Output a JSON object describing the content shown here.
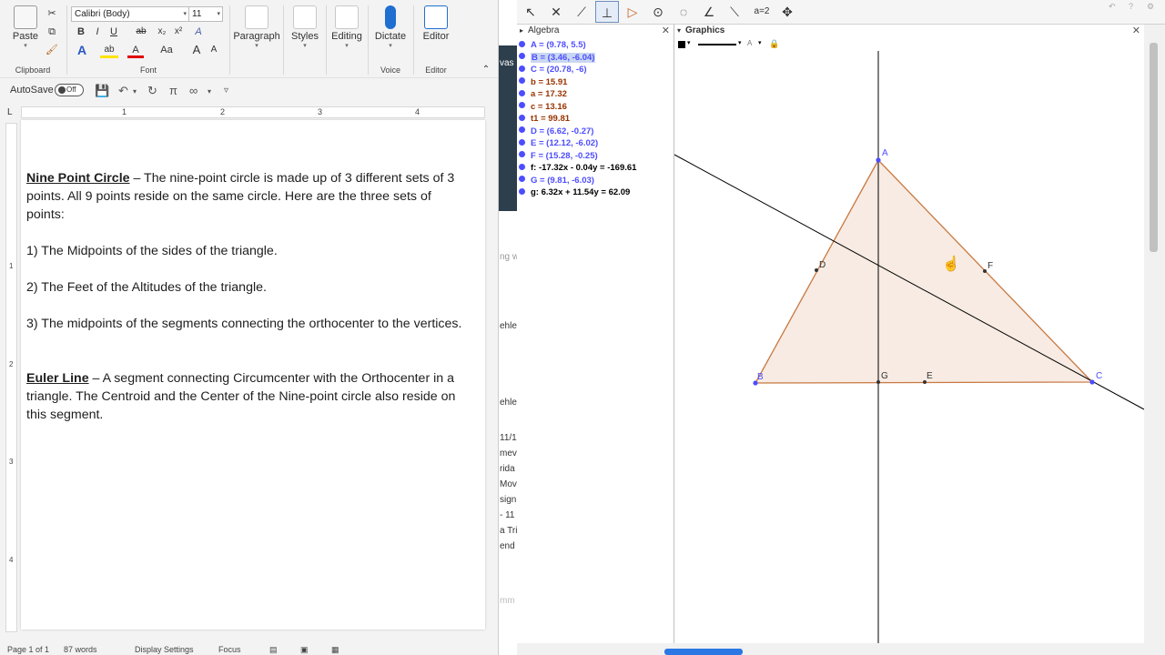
{
  "word": {
    "ribbon": {
      "clipboard": {
        "paste": "Paste",
        "label": "Clipboard"
      },
      "font": {
        "name": "Calibri (Body)",
        "size": "11",
        "bold": "B",
        "italic": "I",
        "underline": "U",
        "strike": "ab",
        "subscript": "x₂",
        "superscript": "x²",
        "clear": "A",
        "effects": "A",
        "highlight": "ab",
        "color": "A",
        "case": "Aa",
        "grow": "A",
        "shrink": "A",
        "label": "Font"
      },
      "paragraph": "Paragraph",
      "styles": "Styles",
      "editing": "Editing",
      "dictate": "Dictate",
      "voice": "Voice",
      "editor": "Editor",
      "editor_group": "Editor"
    },
    "qat": {
      "autosave": "AutoSave",
      "toggle": "Off"
    },
    "ruler": [
      "1",
      "2",
      "3",
      "4"
    ],
    "vruler": [
      "1",
      "2",
      "3",
      "4"
    ],
    "document": {
      "nine_point_term": "Nine Point Circle",
      "nine_point_def": " – The nine-point circle is made up of 3 different sets of 3 points.  All 9 points reside on the same circle.  Here are the three sets of points:",
      "item1": "1)  The Midpoints of the sides of the triangle.",
      "item2": "2)  The Feet of the Altitudes of the triangle.",
      "item3": "3)  The midpoints of the segments connecting the orthocenter to the vertices.",
      "euler_term": "Euler Line",
      "euler_def": " – A segment connecting Circumcenter with the Orthocenter in a triangle.  The Centroid and the Center of the Nine-point circle also reside on this segment."
    },
    "status": {
      "page": "Page 1 of 1",
      "words": "87 words",
      "display_settings": "Display Settings",
      "focus": "Focus"
    }
  },
  "background_window": {
    "fragments": [
      "vas",
      "ng w",
      "ehle",
      "ehle",
      "11/1",
      "mev",
      "rida",
      "Move",
      "signi",
      "- 11",
      "a Tri",
      "end",
      "mm"
    ]
  },
  "geogebra": {
    "algebra_title": "Algebra",
    "graphics_title": "Graphics",
    "colors": {
      "point": "#4d4dff",
      "number": "#993300",
      "line": "#000000",
      "selected": "#c9d7f0",
      "triangle_fill": "#f4e4da",
      "triangle_stroke": "#c87941"
    },
    "algebra_items": [
      {
        "text": "A = (9.78, 5.5)",
        "kind": "point"
      },
      {
        "text": "B = (3.46, -6.04)",
        "kind": "point",
        "selected": true
      },
      {
        "text": "C = (20.78, -6)",
        "kind": "point"
      },
      {
        "text": "b = 15.91",
        "kind": "number"
      },
      {
        "text": "a = 17.32",
        "kind": "number"
      },
      {
        "text": "c = 13.16",
        "kind": "number"
      },
      {
        "text": "t1 = 99.81",
        "kind": "number"
      },
      {
        "text": "D = (6.62, -0.27)",
        "kind": "point"
      },
      {
        "text": "E = (12.12, -6.02)",
        "kind": "point"
      },
      {
        "text": "F = (15.28, -0.25)",
        "kind": "point"
      },
      {
        "text": "f: -17.32x - 0.04y = -169.61",
        "kind": "line"
      },
      {
        "text": "G = (9.81, -6.03)",
        "kind": "point"
      },
      {
        "text": "g: 6.32x + 11.54y = 62.09",
        "kind": "line"
      }
    ],
    "point_labels": [
      "A",
      "B",
      "C",
      "D",
      "E",
      "F",
      "G"
    ],
    "tools": [
      "move",
      "intersect",
      "line",
      "perpendicular",
      "polygon",
      "circle",
      "conic",
      "angle",
      "reflect",
      "slider",
      "move-graphics"
    ]
  }
}
